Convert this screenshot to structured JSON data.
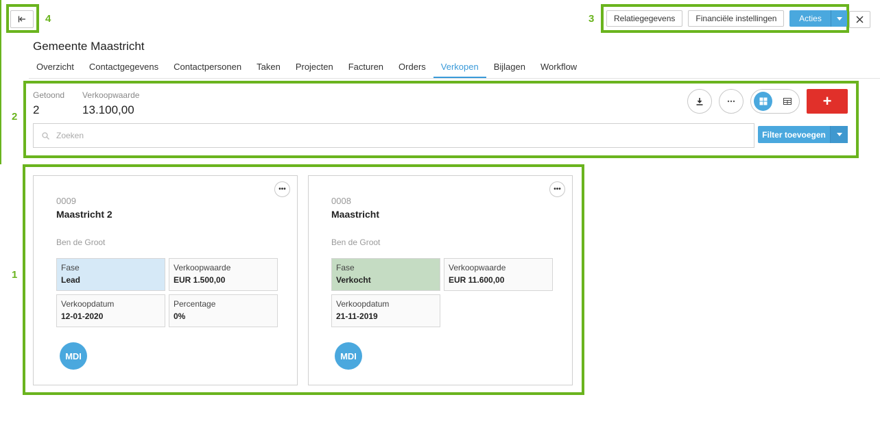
{
  "annotations": [
    "1",
    "2",
    "3",
    "4"
  ],
  "header": {
    "collapse_icon": "collapse-left-icon",
    "buttons": [
      "Relatiegegevens",
      "Financiële instellingen"
    ],
    "actions_label": "Acties",
    "close_icon": "close-icon"
  },
  "title": "Gemeente Maastricht",
  "tabs": [
    "Overzicht",
    "Contactgegevens",
    "Contactpersonen",
    "Taken",
    "Projecten",
    "Facturen",
    "Orders",
    "Verkopen",
    "Bijlagen",
    "Workflow"
  ],
  "active_tab": "Verkopen",
  "stats": [
    {
      "label": "Getoond",
      "value": "2"
    },
    {
      "label": "Verkoopwaarde",
      "value": "13.100,00"
    }
  ],
  "toolbar": {
    "download_icon": "download-icon",
    "more_icon": "more-icon",
    "grid_view_icon": "grid-view-icon",
    "table_view_icon": "table-view-icon",
    "add_label": "+"
  },
  "search": {
    "placeholder": "Zoeken"
  },
  "filter": {
    "label": "Filter toevoegen"
  },
  "colors": {
    "accent": "#4aa8de",
    "add": "#e1302a",
    "annotation": "#6ab41e",
    "lead": "#d6e9f7",
    "verkocht": "#c5dcc3"
  },
  "cards": [
    {
      "number": "0009",
      "title": "Maastricht 2",
      "owner": "Ben de Groot",
      "fields": [
        {
          "label": "Fase",
          "value": "Lead"
        },
        {
          "label": "Verkoopwaarde",
          "value": "EUR 1.500,00"
        },
        {
          "label": "Verkoopdatum",
          "value": "12-01-2020"
        },
        {
          "label": "Percentage",
          "value": "0%"
        }
      ],
      "avatar": "MDI"
    },
    {
      "number": "0008",
      "title": "Maastricht",
      "owner": "Ben de Groot",
      "fields": [
        {
          "label": "Fase",
          "value": "Verkocht"
        },
        {
          "label": "Verkoopwaarde",
          "value": "EUR 11.600,00"
        },
        {
          "label": "Verkoopdatum",
          "value": "21-11-2019"
        }
      ],
      "avatar": "MDI"
    }
  ]
}
